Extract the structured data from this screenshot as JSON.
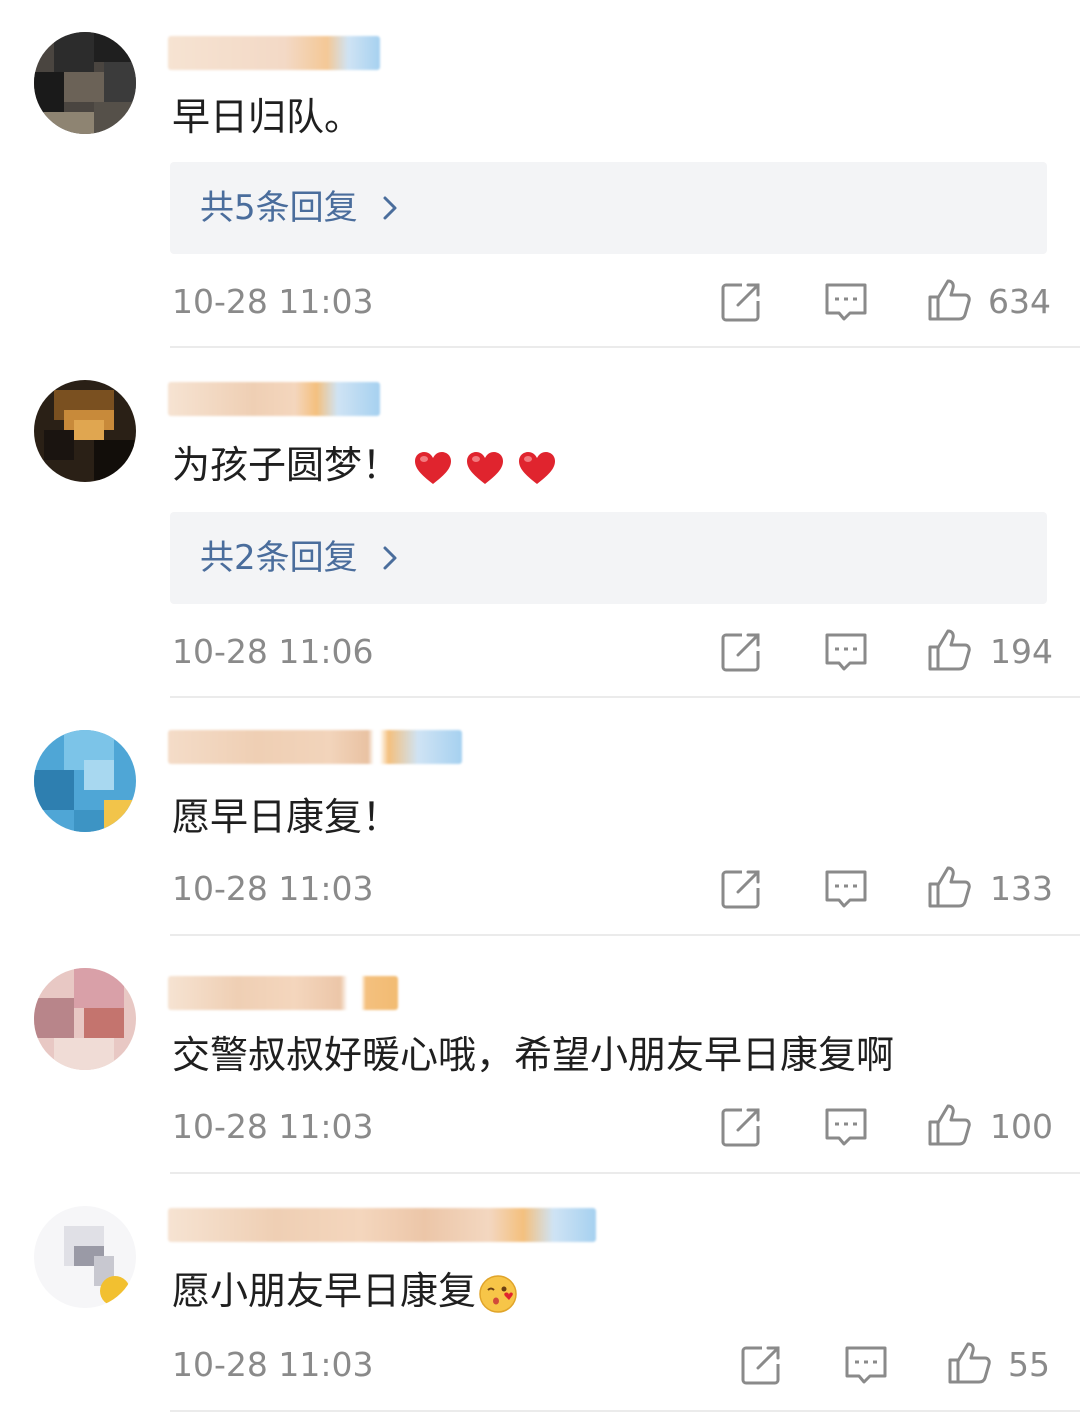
{
  "comments": [
    {
      "text": "早日归队。",
      "reply_label": "共5条回复",
      "time": "10-28 11:03",
      "likes": "634",
      "avatar_colors": [
        "#3b3b3b",
        "#1f1f1f",
        "#6b6257",
        "#2c2c2c",
        "#8e8472"
      ]
    },
    {
      "text": "为孩子圆梦！",
      "reply_label": "共2条回复",
      "time": "10-28 11:06",
      "likes": "194",
      "avatar_colors": [
        "#2a2016",
        "#c88a3a",
        "#7a5020",
        "#1a1410",
        "#e0a650"
      ]
    },
    {
      "text": "愿早日康复！",
      "time": "10-28 11:03",
      "likes": "133",
      "avatar_colors": [
        "#4fa6d6",
        "#7cc4e8",
        "#2e7fb0",
        "#a8d8f0",
        "#f2c44a"
      ]
    },
    {
      "text": "交警叔叔好暖心哦，希望小朋友早日康复啊",
      "time": "10-28 11:03",
      "likes": "100",
      "avatar_colors": [
        "#d9a0a8",
        "#b8858a",
        "#e8c8c4",
        "#c4746e",
        "#f0dcd6"
      ]
    },
    {
      "text": "愿小朋友早日康复",
      "time": "10-28 11:03",
      "likes": "55",
      "avatar_colors": [
        "#e8e8ec",
        "#9a9aa6",
        "#c8c8d0",
        "#f6f6f8",
        "#f2c030"
      ]
    }
  ],
  "icons": {
    "share": "share-icon",
    "comment": "comment-icon",
    "like": "thumbs-up-icon",
    "chevron": "chevron-right-icon",
    "heart": "red-heart-emoji",
    "face": "face-blowing-kiss-emoji"
  },
  "colors": {
    "reply_link": "#4a6d9c",
    "meta_text": "#8a8a8a",
    "reply_bg": "#f3f4f6",
    "heart": "#e0242e"
  }
}
